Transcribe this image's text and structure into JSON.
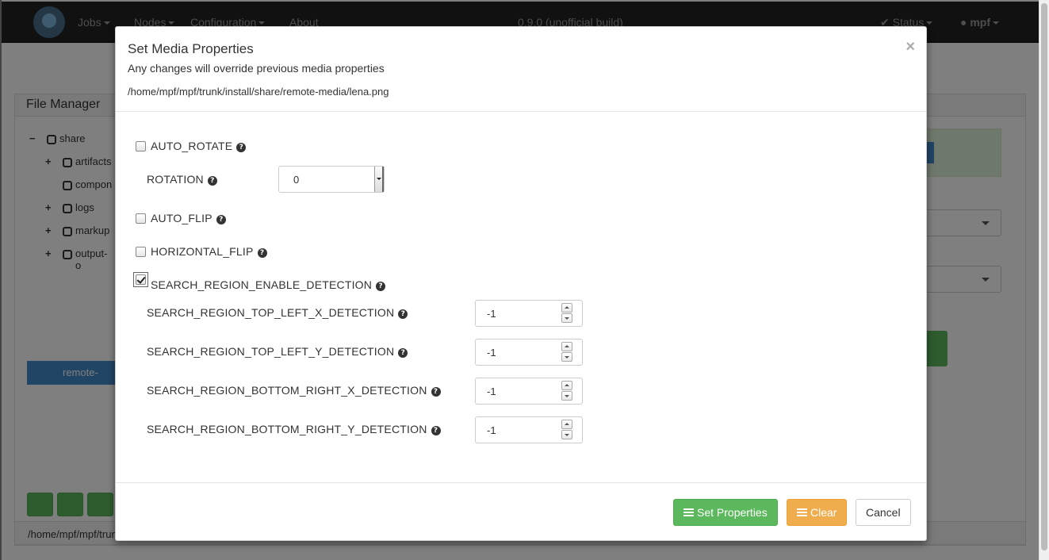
{
  "background": {
    "navbar": {
      "items": [
        {
          "label": "Jobs"
        },
        {
          "label": "Nodes"
        },
        {
          "label": "Configuration"
        },
        {
          "label": "About"
        }
      ],
      "version": "0.9.0 (unofficial build)",
      "status_label": "Status",
      "user_label": "mpf"
    },
    "file_manager": {
      "title": "File Manager",
      "tree": [
        {
          "label": "share",
          "expander": "−"
        },
        {
          "label": "artifacts",
          "expander": "+"
        },
        {
          "label": "compon",
          "expander": ""
        },
        {
          "label": "logs",
          "expander": "+"
        },
        {
          "label": "markup",
          "expander": "+"
        },
        {
          "label": "output-o",
          "expander": "+"
        }
      ],
      "selected_label": "remote-",
      "path": "/home/mpf/mpf/trunk/install/share/remote-media"
    }
  },
  "modal": {
    "title": "Set Media Properties",
    "subtitle": "Any changes will override previous media properties",
    "file_path": "/home/mpf/mpf/trunk/install/share/remote-media/lena.png",
    "close_label": "×",
    "fields": {
      "auto_rotate": {
        "label": "AUTO_ROTATE",
        "checked": false
      },
      "rotation": {
        "label": "ROTATION",
        "value": "0"
      },
      "auto_flip": {
        "label": "AUTO_FLIP",
        "checked": false
      },
      "horizontal_flip": {
        "label": "HORIZONTAL_FLIP",
        "checked": false
      },
      "search_region_enable": {
        "label": "SEARCH_REGION_ENABLE_DETECTION",
        "checked": true
      },
      "top_left_x": {
        "label": "SEARCH_REGION_TOP_LEFT_X_DETECTION",
        "value": "-1"
      },
      "top_left_y": {
        "label": "SEARCH_REGION_TOP_LEFT_Y_DETECTION",
        "value": "-1"
      },
      "bottom_right_x": {
        "label": "SEARCH_REGION_BOTTOM_RIGHT_X_DETECTION",
        "value": "-1"
      },
      "bottom_right_y": {
        "label": "SEARCH_REGION_BOTTOM_RIGHT_Y_DETECTION",
        "value": "-1"
      }
    },
    "help_glyph": "?",
    "buttons": {
      "set_properties": "Set Properties",
      "clear": "Clear",
      "cancel": "Cancel"
    }
  },
  "colors": {
    "navbar_bg": "#222222",
    "success": "#5cb85c",
    "warning": "#f0ad4e",
    "primary": "#428bca"
  }
}
